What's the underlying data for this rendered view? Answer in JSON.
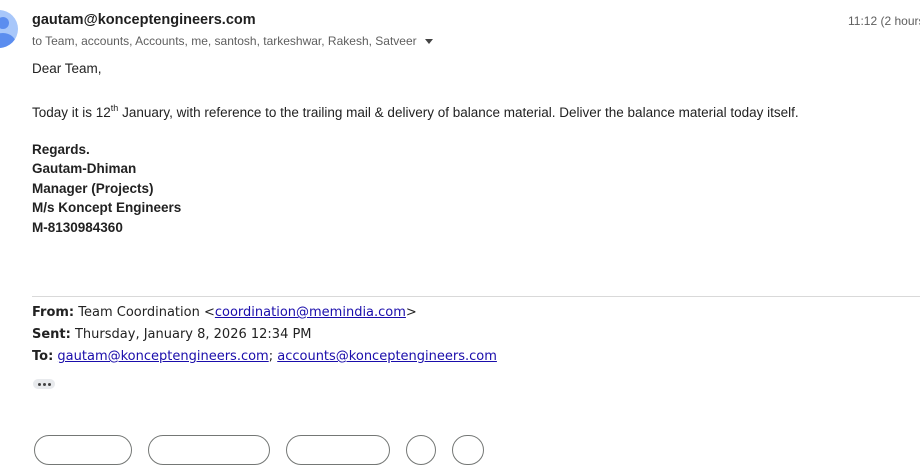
{
  "header": {
    "sender": "gautam@konceptengineers.com",
    "recipients": "to Team, accounts, Accounts, me, santosh, tarkeshwar, Rakesh, Satveer",
    "time": "11:12 (2 hours"
  },
  "body": {
    "greeting": "Dear Team,",
    "line_before_sup": "Today it is 12",
    "sup": "th",
    "line_after_sup": " January, with reference to the trailing mail & delivery of balance material. Deliver the balance material today itself.",
    "signature": [
      "Regards.",
      "Gautam-Dhiman",
      "Manager (Projects)",
      "M/s Koncept Engineers",
      "M-8130984360"
    ]
  },
  "quoted": {
    "from_label": "From:",
    "from_name": " Team Coordination <",
    "from_email": "coordination@memindia.com",
    "from_close": ">",
    "sent_label": "Sent:",
    "sent_value": " Thursday, January 8, 2026 12:34 PM",
    "to_label": "To:",
    "to_email1": "gautam@konceptengineers.com",
    "to_sep": "; ",
    "to_email2": "accounts@konceptengineers.com"
  },
  "icons": {
    "avatar": "person-avatar-icon",
    "caret": "chevron-down-icon",
    "more": "more-horiz-icon"
  },
  "colors": {
    "link": "#1a0dab",
    "avatar_bg": "#a8c7fa",
    "avatar_fg": "#5b8def"
  }
}
